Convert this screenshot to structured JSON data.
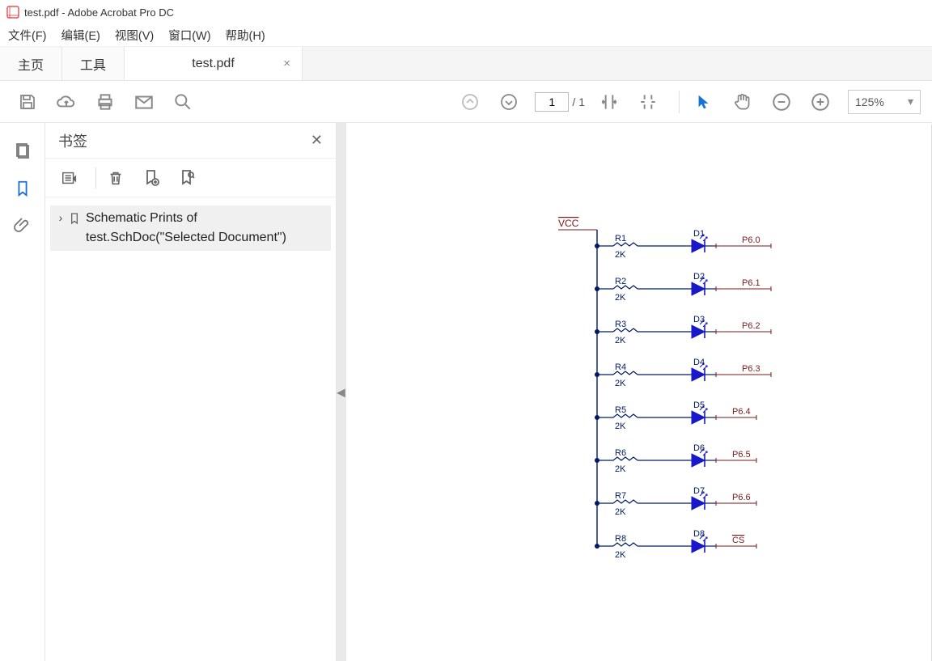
{
  "title": "test.pdf - Adobe Acrobat Pro DC",
  "menus": {
    "file": "文件(F)",
    "edit": "编辑(E)",
    "view": "视图(V)",
    "window": "窗口(W)",
    "help": "帮助(H)"
  },
  "tabs": {
    "home": "主页",
    "tools": "工具",
    "doc": "test.pdf"
  },
  "page_current": "1",
  "page_sep": "/",
  "page_total": "1",
  "zoom": "125%",
  "bookmarks": {
    "panel_title": "书签",
    "item1_line1": "Schematic Prints of",
    "item1_line2": "test.SchDoc(\"Selected Document\")"
  },
  "schematic": {
    "vcc": "VCC",
    "rows": [
      {
        "r": "R1",
        "rv": "2K",
        "d": "D1",
        "net": "P6.0"
      },
      {
        "r": "R2",
        "rv": "2K",
        "d": "D2",
        "net": "P6.1"
      },
      {
        "r": "R3",
        "rv": "2K",
        "d": "D3",
        "net": "P6.2"
      },
      {
        "r": "R4",
        "rv": "2K",
        "d": "D4",
        "net": "P6.3"
      },
      {
        "r": "R5",
        "rv": "2K",
        "d": "D5",
        "net": "P6.4"
      },
      {
        "r": "R6",
        "rv": "2K",
        "d": "D6",
        "net": "P6.5"
      },
      {
        "r": "R7",
        "rv": "2K",
        "d": "D7",
        "net": "P6.6"
      },
      {
        "r": "R8",
        "rv": "2K",
        "d": "D8",
        "net": "CS"
      }
    ]
  }
}
